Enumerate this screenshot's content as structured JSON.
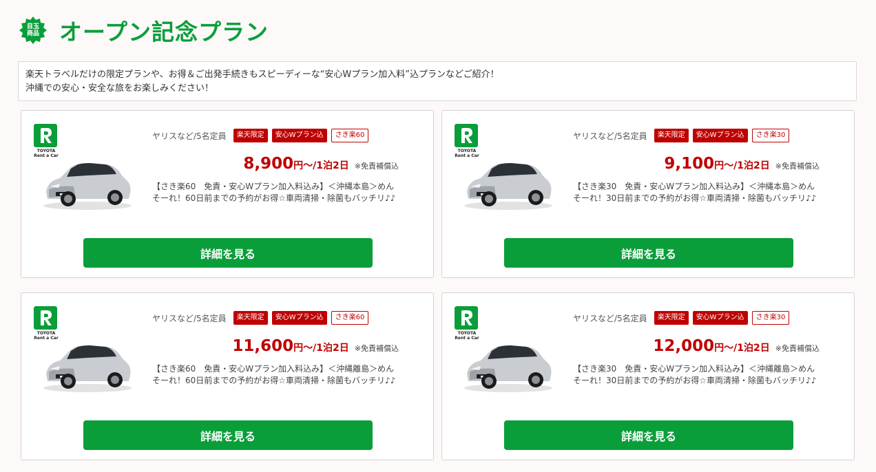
{
  "header": {
    "badge_line1": "目玉",
    "badge_line2": "商品",
    "title": "オープン記念プラン"
  },
  "intro": {
    "line1": "楽天トラベルだけの限定プランや、お得＆ご出発手続きもスピーディーな“安心Wプラン加入料”込プランなどご紹介！",
    "line2": "沖縄での安心・安全な旅をお楽しみください！"
  },
  "logo": {
    "line1": "TOYOTA",
    "line2": "Rent a Car"
  },
  "colors": {
    "brand_green": "#0a9e3a",
    "rakuten_red": "#bf0000"
  },
  "plans": [
    {
      "capacity": "ヤリスなど/5名定員",
      "tags": [
        "楽天限定",
        "安心Wプラン込",
        "さき楽60"
      ],
      "price": "8,900",
      "unit": "円〜/1泊2日",
      "note": "※免責補償込",
      "desc": "【さき楽60　免責・安心Wプラン加入料込み】＜沖縄本島＞めんそーれ！60日前までの予約がお得☆車両清掃・除菌もバッチリ♪♪",
      "button": "詳細を見る"
    },
    {
      "capacity": "ヤリスなど/5名定員",
      "tags": [
        "楽天限定",
        "安心Wプラン込",
        "さき楽30"
      ],
      "price": "9,100",
      "unit": "円〜/1泊2日",
      "note": "※免責補償込",
      "desc": "【さき楽30　免責・安心Wプラン加入料込み】＜沖縄本島＞めんそーれ！30日前までの予約がお得☆車両清掃・除菌もバッチリ♪♪",
      "button": "詳細を見る"
    },
    {
      "capacity": "ヤリスなど/5名定員",
      "tags": [
        "楽天限定",
        "安心Wプラン込",
        "さき楽60"
      ],
      "price": "11,600",
      "unit": "円〜/1泊2日",
      "note": "※免責補償込",
      "desc": "【さき楽60　免責・安心Wプラン加入料込み】＜沖縄離島＞めんそーれ！60日前までの予約がお得☆車両清掃・除菌もバッチリ♪♪",
      "button": "詳細を見る"
    },
    {
      "capacity": "ヤリスなど/5名定員",
      "tags": [
        "楽天限定",
        "安心Wプラン込",
        "さき楽30"
      ],
      "price": "12,000",
      "unit": "円〜/1泊2日",
      "note": "※免責補償込",
      "desc": "【さき楽30　免責・安心Wプラン加入料込み】＜沖縄離島＞めんそーれ！30日前までの予約がお得☆車両清掃・除菌もバッチリ♪♪",
      "button": "詳細を見る"
    }
  ]
}
